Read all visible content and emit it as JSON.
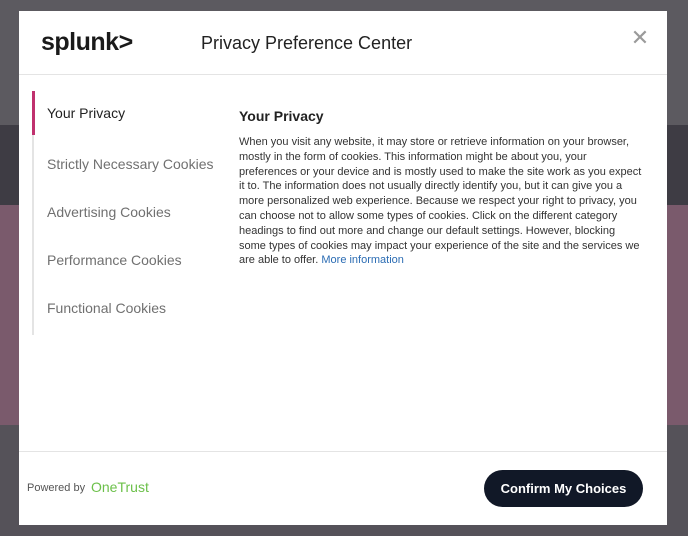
{
  "modal": {
    "logo": "splunk>",
    "title": "Privacy Preference Center",
    "close_symbol": "✕"
  },
  "tabs": [
    {
      "label": "Your Privacy",
      "active": true
    },
    {
      "label": "Strictly Necessary Cookies",
      "active": false
    },
    {
      "label": "Advertising Cookies",
      "active": false
    },
    {
      "label": "Performance Cookies",
      "active": false
    },
    {
      "label": "Functional Cookies",
      "active": false
    }
  ],
  "content": {
    "heading": "Your Privacy",
    "body": "When you visit any website, it may store or retrieve information on your browser, mostly in the form of cookies. This information might be about you, your preferences or your device and is mostly used to make the site work as you expect it to. The information does not usually directly identify you, but it can give you a more personalized web experience. Because we respect your right to privacy, you can choose not to allow some types of cookies. Click on the different category headings to find out more and change our default settings. However, blocking some types of cookies may impact your experience of the site and the services we are able to offer.",
    "more_link": "More information"
  },
  "footer": {
    "powered_by": "Powered by",
    "brand": "OneTrust",
    "confirm_label": "Confirm My Choices"
  },
  "colors": {
    "accent": "#c0316e",
    "link": "#2b6cb3",
    "brand_green": "#6cc04a",
    "button_bg": "#111827"
  }
}
